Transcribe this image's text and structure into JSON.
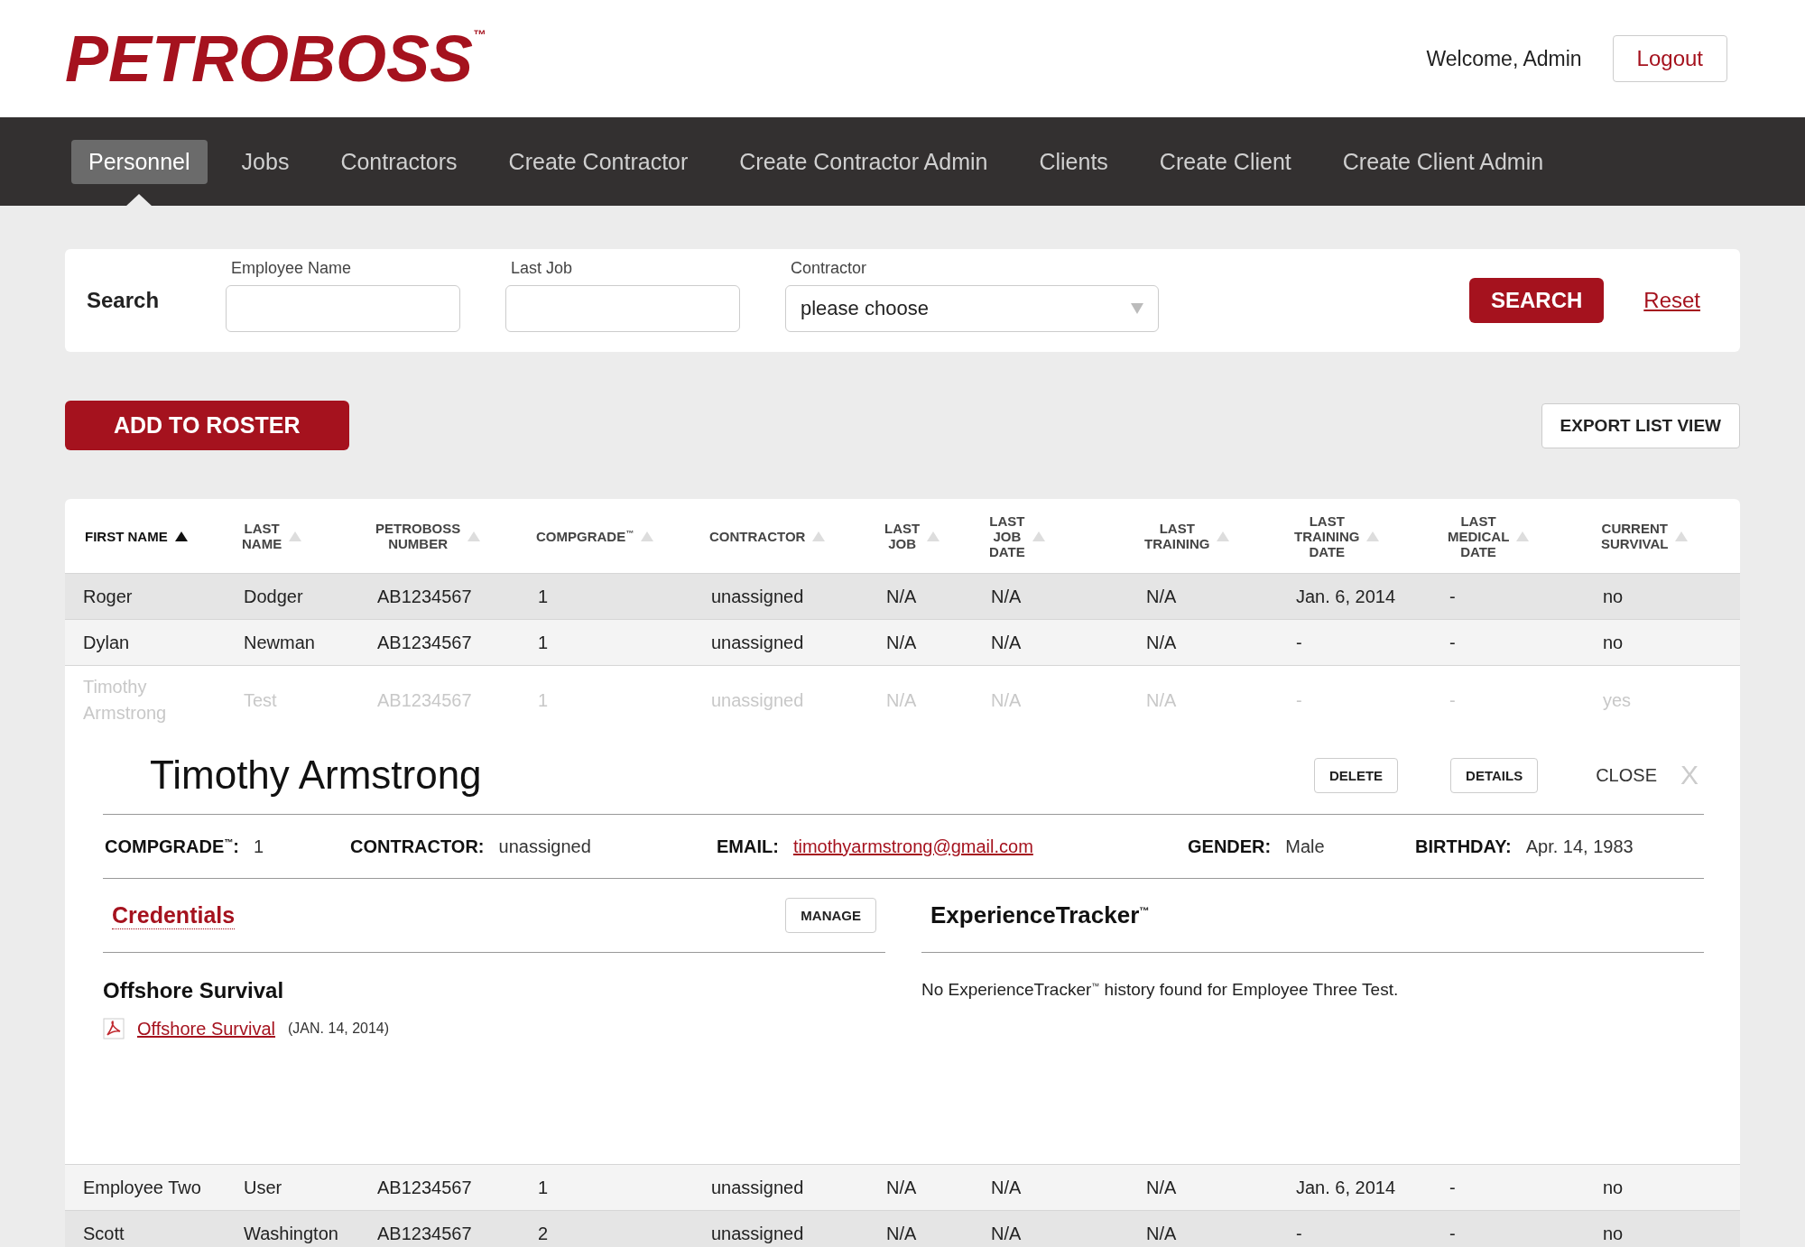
{
  "header": {
    "logo": "PETROBOSS$^{™}$",
    "welcome": "Welcome, Admin",
    "logout": "Logout"
  },
  "nav": [
    {
      "label": "Personnel",
      "selected": true
    },
    {
      "label": "Jobs",
      "selected": false
    },
    {
      "label": "Contractors",
      "selected": false
    },
    {
      "label": "Create Contractor",
      "selected": false
    },
    {
      "label": "Create Contractor Admin",
      "selected": false
    },
    {
      "label": "Clients",
      "selected": false
    },
    {
      "label": "Create Client",
      "selected": false
    },
    {
      "label": "Create Client Admin",
      "selected": false
    }
  ],
  "search": {
    "title": "Search",
    "fields": [
      {
        "label": "Employee Name",
        "kind": "text"
      },
      {
        "label": "Last Job",
        "kind": "text"
      },
      {
        "label": "Contractor",
        "kind": "select",
        "value": "please choose"
      }
    ],
    "button": "SEARCH",
    "reset": "Reset"
  },
  "actions": {
    "add": "ADD TO ROSTER",
    "export": "EXPORT LIST VIEW"
  },
  "table": {
    "columns": [
      {
        "label": "FIRST NAME",
        "sorted": true
      },
      {
        "label": "LAST NAME",
        "sorted": false
      },
      {
        "label": "PETROBOSS NUMBER",
        "sorted": false
      },
      {
        "label": "COMPGRADE$^{™}$",
        "sorted": false
      },
      {
        "label": "CONTRACTOR",
        "sorted": false
      },
      {
        "label": "LAST JOB",
        "sorted": false
      },
      {
        "label": "LAST JOB DATE",
        "sorted": false
      },
      {
        "label": "LAST TRAINING",
        "sorted": false
      },
      {
        "label": "LAST TRAINING DATE",
        "sorted": false
      },
      {
        "label": "LAST MEDICAL DATE",
        "sorted": false
      },
      {
        "label": "CURRENT SURVIVAL",
        "sorted": false
      }
    ],
    "rows": [
      {
        "expanded": false,
        "cells": [
          "Roger",
          "Dodger",
          "AB1234567",
          "1",
          "unassigned",
          "N/A",
          "N/A",
          "N/A",
          "Jan. 6, 2014",
          "-",
          "no"
        ]
      },
      {
        "expanded": false,
        "cells": [
          "Dylan",
          "Newman",
          "AB1234567",
          "1",
          "unassigned",
          "N/A",
          "N/A",
          "N/A",
          "-",
          "-",
          "no"
        ]
      },
      {
        "expanded": true,
        "cells": [
          "Timothy Armstrong",
          "Test",
          "AB1234567",
          "1",
          "unassigned",
          "N/A",
          "N/A",
          "N/A",
          "-",
          "-",
          "yes"
        ]
      },
      {
        "expanded": false,
        "cells": [
          "Employee Two",
          "User",
          "AB1234567",
          "1",
          "unassigned",
          "N/A",
          "N/A",
          "N/A",
          "Jan. 6, 2014",
          "-",
          "no"
        ]
      },
      {
        "expanded": false,
        "cells": [
          "Scott",
          "Washington",
          "AB1234567",
          "2",
          "unassigned",
          "N/A",
          "N/A",
          "N/A",
          "-",
          "-",
          "no"
        ]
      }
    ]
  },
  "detail": {
    "name": "Timothy Armstrong",
    "buttons": [
      "DELETE",
      "DETAILS"
    ],
    "close": "CLOSE",
    "close_icon": "X",
    "fields": [
      {
        "label": "COMPGRADE$^{™}$:",
        "value": "1",
        "kind": "text"
      },
      {
        "label": "CONTRACTOR:",
        "value": "unassigned",
        "kind": "text"
      },
      {
        "label": "EMAIL:",
        "value": "timothyarmstrong@gmail.com",
        "kind": "link"
      },
      {
        "label": "GENDER:",
        "value": "Male",
        "kind": "text"
      },
      {
        "label": "BIRTHDAY:",
        "value": "Apr. 14, 1983",
        "kind": "text"
      }
    ],
    "credentials": {
      "title": "Credentials",
      "manage": "MANAGE",
      "groups": [
        {
          "title": "Offshore Survival",
          "files": [
            {
              "name": "Offshore Survival",
              "date": "(JAN. 14, 2014)"
            }
          ]
        }
      ]
    },
    "experience": {
      "title": "ExperienceTracker$^{™}$",
      "message": "No ExperienceTracker$^{™}$ history found for Employee Three Test."
    }
  }
}
